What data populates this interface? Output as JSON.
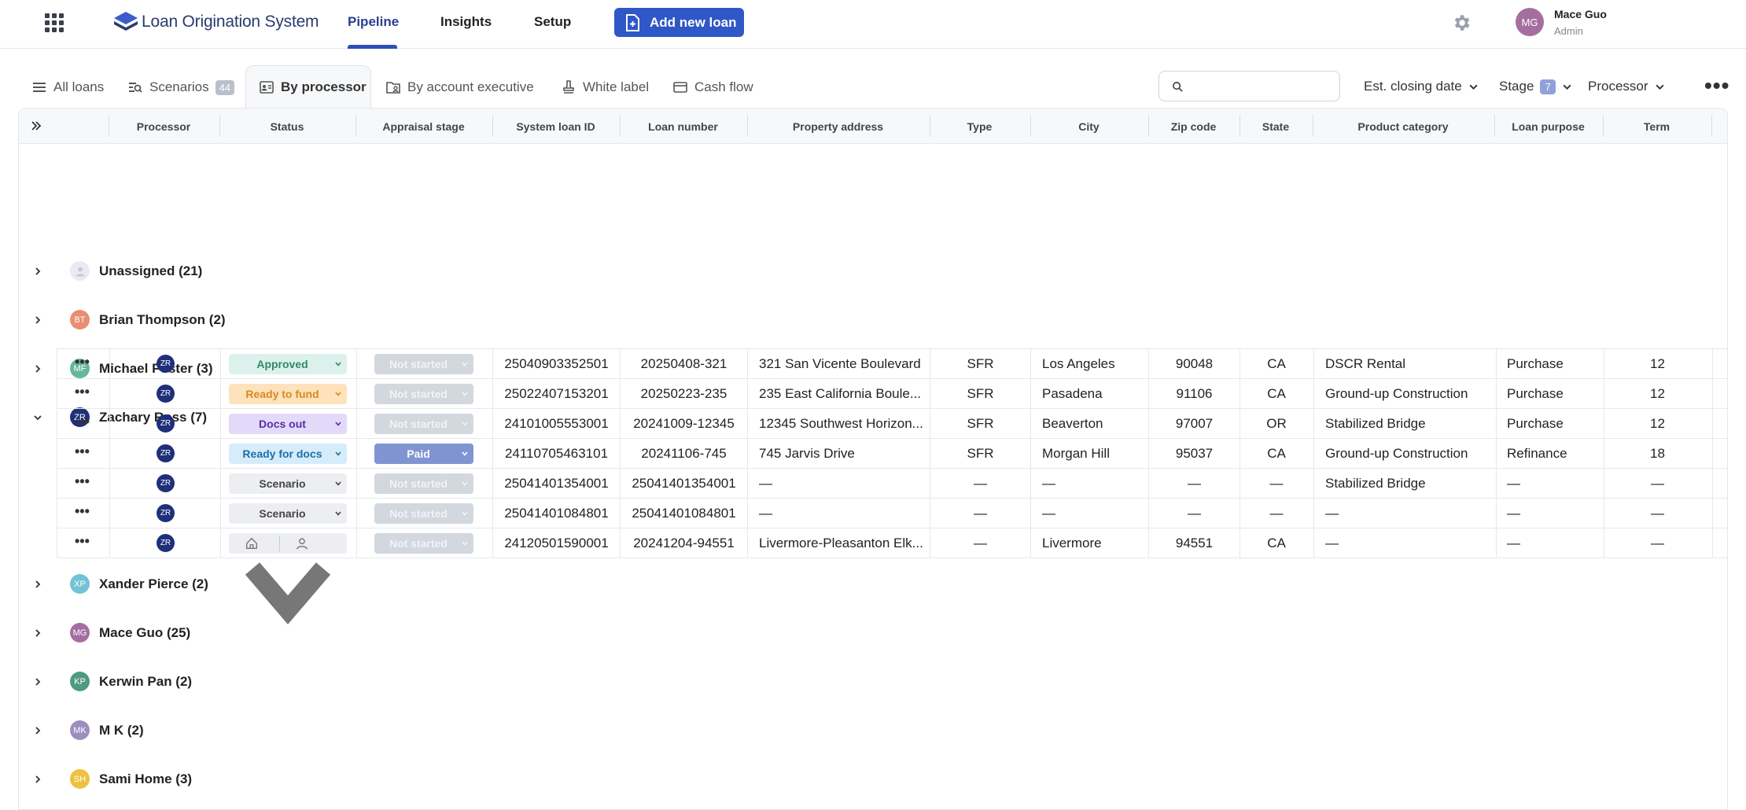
{
  "app": {
    "brand": "Loan Origination System",
    "nav": [
      "Pipeline",
      "Insights",
      "Setup"
    ],
    "active_nav": "Pipeline",
    "add_button": "Add new loan",
    "user": {
      "initials": "MG",
      "name": "Mace Guo",
      "role": "Admin"
    }
  },
  "tabs": {
    "all_loans": "All loans",
    "scenarios": "Scenarios",
    "scenarios_count": "44",
    "by_processor": "By processor",
    "by_account_exec": "By account executive",
    "white_label": "White label",
    "cash_flow": "Cash flow"
  },
  "filters": {
    "search_value": "",
    "closing_date": "Est. closing date",
    "stage": "Stage",
    "stage_count": "7",
    "processor": "Processor"
  },
  "columns": [
    "Processor",
    "Status",
    "Appraisal stage",
    "System loan ID",
    "Loan number",
    "Property address",
    "Type",
    "City",
    "Zip code",
    "State",
    "Product category",
    "Loan purpose",
    "Term"
  ],
  "groups": [
    {
      "initials": "",
      "label": "Unassigned (21)",
      "expanded": false
    },
    {
      "initials": "BT",
      "label": "Brian Thompson (2)",
      "expanded": false,
      "color": "#e98e6f"
    },
    {
      "initials": "MF",
      "label": "Michael Foster (3)",
      "expanded": false,
      "color": "#66b79b"
    },
    {
      "initials": "ZR",
      "label": "Zachary Ross (7)",
      "expanded": true,
      "color": "#1f2f7a"
    },
    {
      "initials": "XP",
      "label": "Xander Pierce (2)",
      "expanded": false,
      "color": "#74c2d6"
    },
    {
      "initials": "MG",
      "label": "Mace Guo (25)",
      "expanded": false,
      "color": "#a56ea0"
    },
    {
      "initials": "KP",
      "label": "Kerwin Pan (2)",
      "expanded": false,
      "color": "#4e9a82"
    },
    {
      "initials": "MK",
      "label": "M K (2)",
      "expanded": false,
      "color": "#9b8fc0"
    },
    {
      "initials": "SH",
      "label": "Sami Home (3)",
      "expanded": false,
      "color": "#f0c040"
    }
  ],
  "rows": [
    {
      "processor": "ZR",
      "status": "Approved",
      "status_bg": "#dcf1ec",
      "status_fg": "#2f8a67",
      "appraisal": "Not started",
      "system_id": "25040903352501",
      "loan_number": "20250408-321",
      "address": "321 San Vicente Boulevard",
      "type": "SFR",
      "city": "Los Angeles",
      "zip": "90048",
      "state": "CA",
      "product": "DSCR Rental",
      "purpose": "Purchase",
      "term": "12"
    },
    {
      "processor": "ZR",
      "status": "Ready to fund",
      "status_bg": "#fde2bb",
      "status_fg": "#d98a1f",
      "appraisal": "Not started",
      "system_id": "25022407153201",
      "loan_number": "20250223-235",
      "address": "235 East California Boule...",
      "type": "SFR",
      "city": "Pasadena",
      "zip": "91106",
      "state": "CA",
      "product": "Ground-up Construction",
      "purpose": "Purchase",
      "term": "12"
    },
    {
      "processor": "ZR",
      "status": "Docs out",
      "status_bg": "#e3dafa",
      "status_fg": "#5a2fa0",
      "appraisal": "Not started",
      "system_id": "24101005553001",
      "loan_number": "20241009-12345",
      "address": "12345 Southwest Horizon...",
      "type": "SFR",
      "city": "Beaverton",
      "zip": "97007",
      "state": "OR",
      "product": "Stabilized Bridge",
      "purpose": "Purchase",
      "term": "12"
    },
    {
      "processor": "ZR",
      "status": "Ready for docs",
      "status_bg": "#d6ecfa",
      "status_fg": "#1d6fa8",
      "appraisal": "Paid",
      "system_id": "24110705463101",
      "loan_number": "20241106-745",
      "address": "745 Jarvis Drive",
      "type": "SFR",
      "city": "Morgan Hill",
      "zip": "95037",
      "state": "CA",
      "product": "Ground-up Construction",
      "purpose": "Refinance",
      "term": "18"
    },
    {
      "processor": "ZR",
      "status": "Scenario",
      "status_bg": "#eceef1",
      "status_fg": "#444",
      "appraisal": "Not started",
      "system_id": "25041401354001",
      "loan_number": "25041401354001",
      "address": "—",
      "type": "—",
      "city": "—",
      "zip": "—",
      "state": "—",
      "product": "Stabilized Bridge",
      "purpose": "—",
      "term": "—"
    },
    {
      "processor": "ZR",
      "status": "Scenario",
      "status_bg": "#eceef1",
      "status_fg": "#444",
      "appraisal": "Not started",
      "system_id": "25041401084801",
      "loan_number": "25041401084801",
      "address": "—",
      "type": "—",
      "city": "—",
      "zip": "—",
      "state": "—",
      "product": "—",
      "purpose": "—",
      "term": "—"
    },
    {
      "processor": "ZR",
      "status": "",
      "status_bg": "#eceef1",
      "status_fg": "#444",
      "appraisal": "Not started",
      "system_id": "24120501590001",
      "loan_number": "20241204-94551",
      "address": "Livermore-Pleasanton Elk...",
      "type": "—",
      "city": "Livermore",
      "zip": "94551",
      "state": "CA",
      "product": "—",
      "purpose": "—",
      "term": "—"
    }
  ]
}
